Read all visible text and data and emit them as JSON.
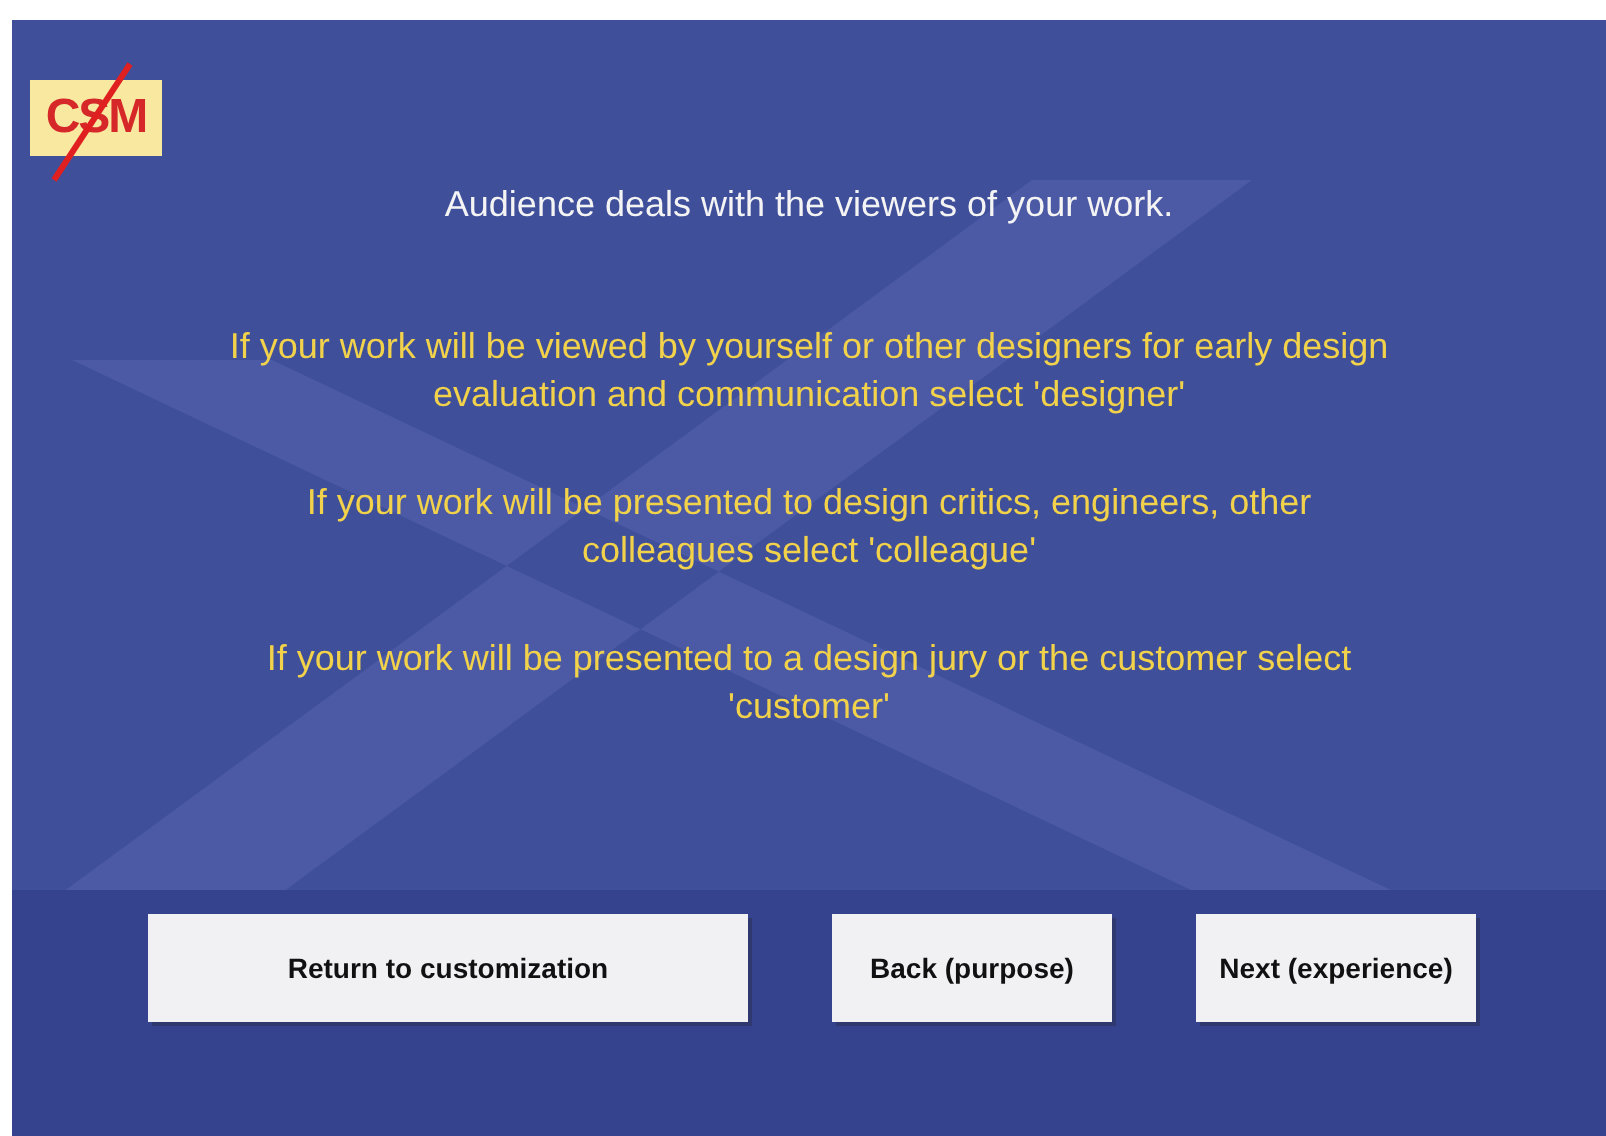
{
  "logo": {
    "text": "CSM"
  },
  "heading": "Audience deals with the viewers of your work.",
  "paragraphs": [
    "If your work will be viewed by yourself or other designers for early design evaluation and communication select 'designer'",
    "If your work will be presented to design critics, engineers, other colleagues select 'colleague'",
    "If your work will be presented to a design jury or the customer select 'customer'"
  ],
  "buttons": [
    {
      "label": "Return to customization",
      "kind": "wide"
    },
    {
      "label": "Back (purpose)",
      "kind": "narrow"
    },
    {
      "label": "Next (experience)",
      "kind": "narrow"
    }
  ]
}
